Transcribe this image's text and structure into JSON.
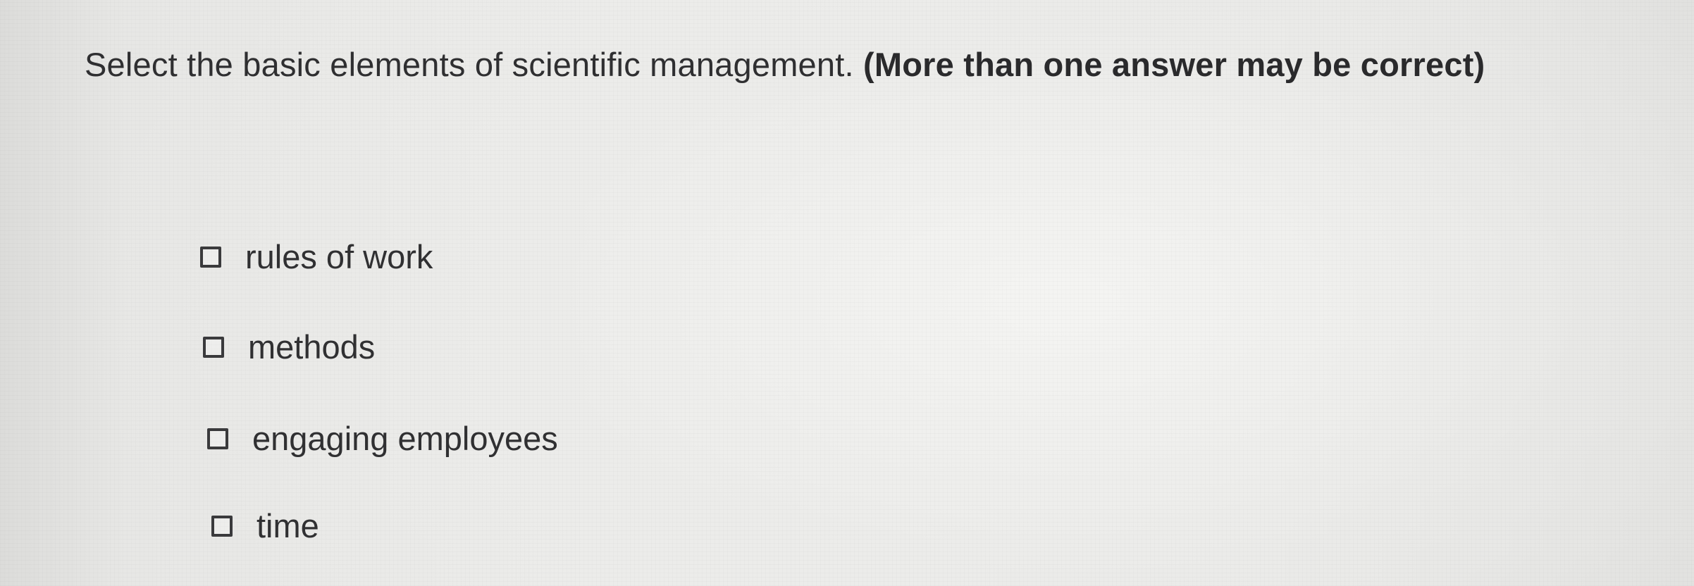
{
  "question": {
    "prompt": "Select the basic elements of scientific management.",
    "instruction": "(More than one answer may be correct)"
  },
  "options": [
    {
      "label": "rules of work",
      "checked": false
    },
    {
      "label": "methods",
      "checked": false
    },
    {
      "label": "engaging employees",
      "checked": false
    },
    {
      "label": "time",
      "checked": false
    }
  ]
}
